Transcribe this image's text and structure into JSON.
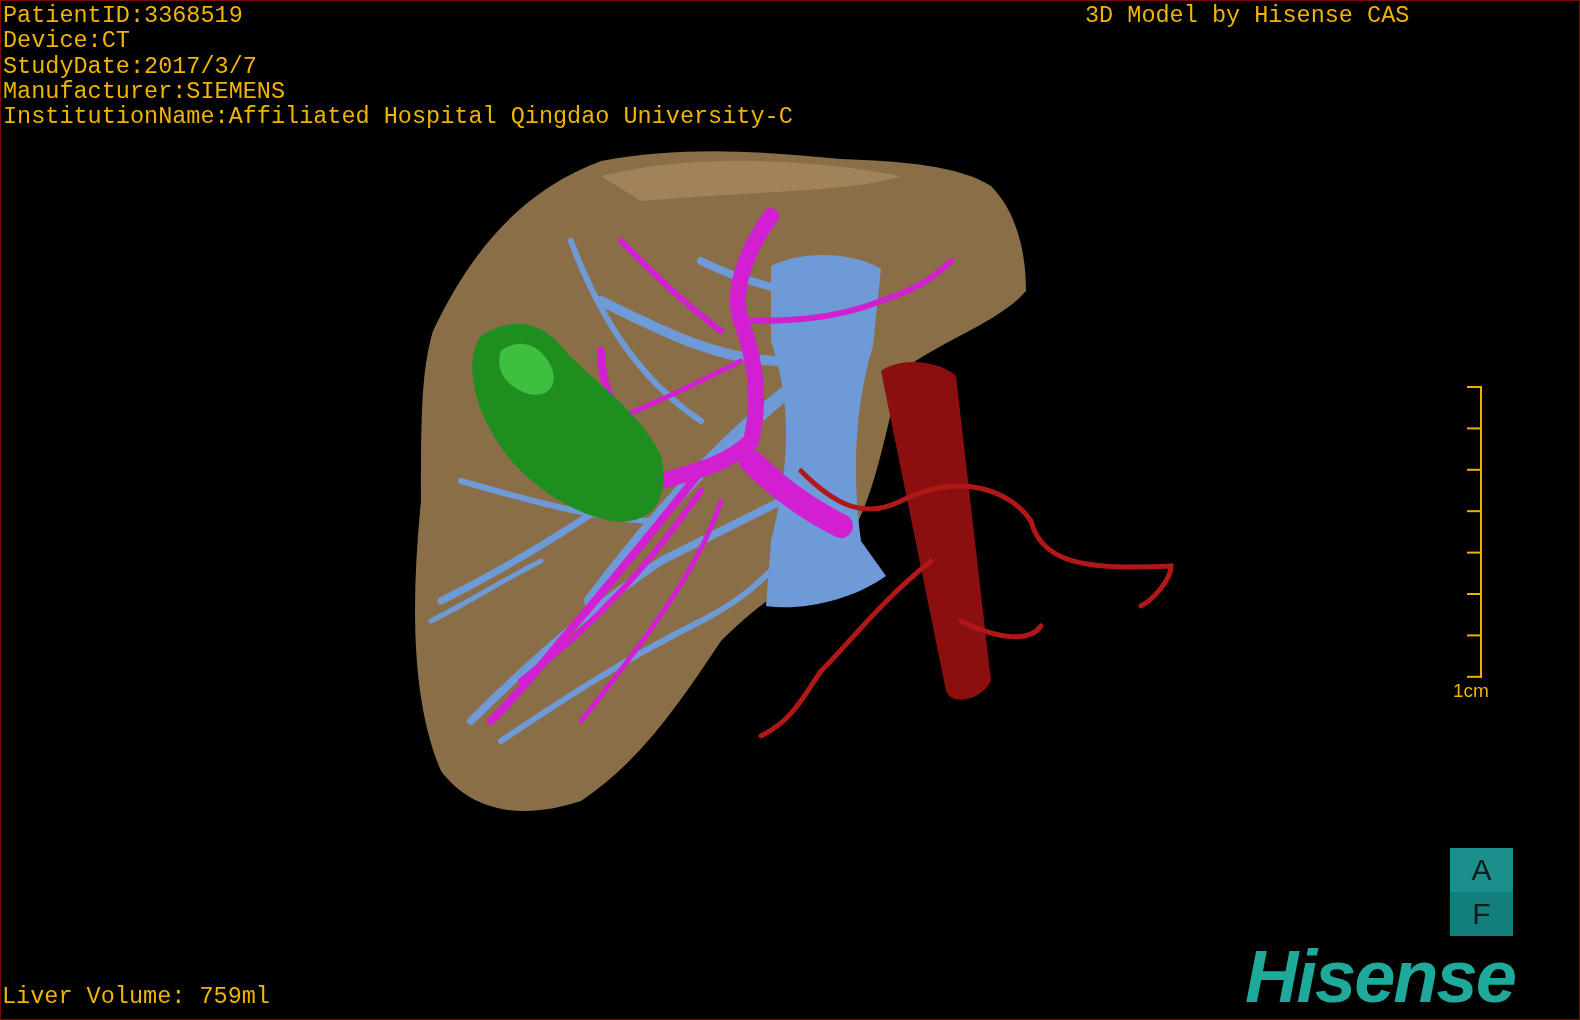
{
  "info_lines": [
    "PatientID:3368519",
    "Device:CT",
    "StudyDate:2017/3/7",
    "Manufacturer:SIEMENS",
    "InstitutionName:Affiliated Hospital Qingdao University-C"
  ],
  "title": "3D Model by Hisense CAS",
  "scale_bar": {
    "label": "1cm"
  },
  "volume": "Liver Volume: 759ml",
  "orientation_cube": {
    "top": "A",
    "bottom": "F"
  },
  "logo": "Hisense"
}
